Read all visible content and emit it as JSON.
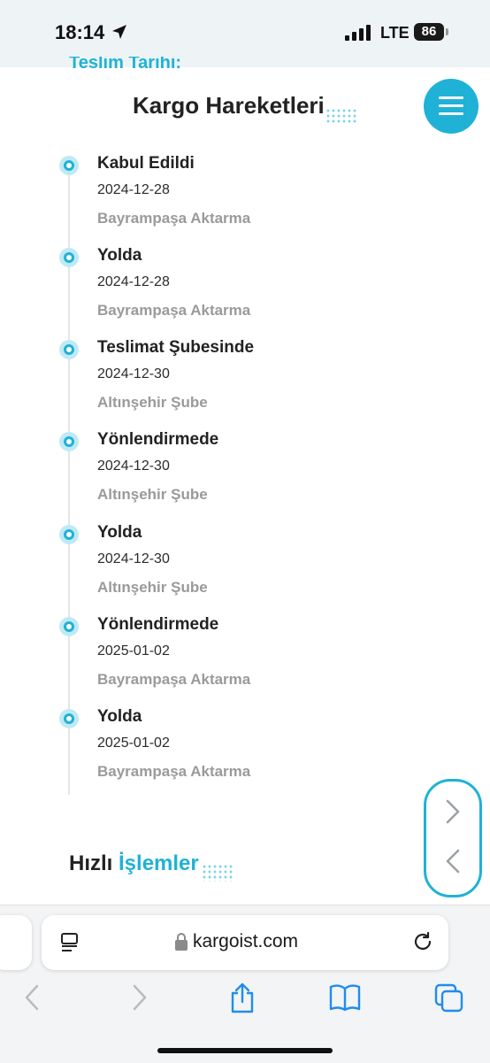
{
  "status_bar": {
    "time": "18:14",
    "network": "LTE",
    "battery": "86"
  },
  "page": {
    "cut_off_label": "Teslim Tarihi:",
    "section_title": "Kargo Hareketleri",
    "events": [
      {
        "status": "Kabul Edildi",
        "date": "2024-12-28",
        "location": "Bayrampaşa Aktarma"
      },
      {
        "status": "Yolda",
        "date": "2024-12-28",
        "location": "Bayrampaşa Aktarma"
      },
      {
        "status": "Teslimat Şubesinde",
        "date": "2024-12-30",
        "location": "Altınşehir Şube"
      },
      {
        "status": "Yönlendirmede",
        "date": "2024-12-30",
        "location": "Altınşehir Şube"
      },
      {
        "status": "Yolda",
        "date": "2024-12-30",
        "location": "Altınşehir Şube"
      },
      {
        "status": "Yönlendirmede",
        "date": "2025-01-02",
        "location": "Bayrampaşa Aktarma"
      },
      {
        "status": "Yolda",
        "date": "2025-01-02",
        "location": "Bayrampaşa Aktarma"
      }
    ],
    "quick_actions_title_1": "Hızlı",
    "quick_actions_title_2": "İşlemler"
  },
  "browser": {
    "url": "kargoist.com"
  },
  "colors": {
    "accent": "#1fb2d6",
    "muted": "#9a9a9a"
  }
}
